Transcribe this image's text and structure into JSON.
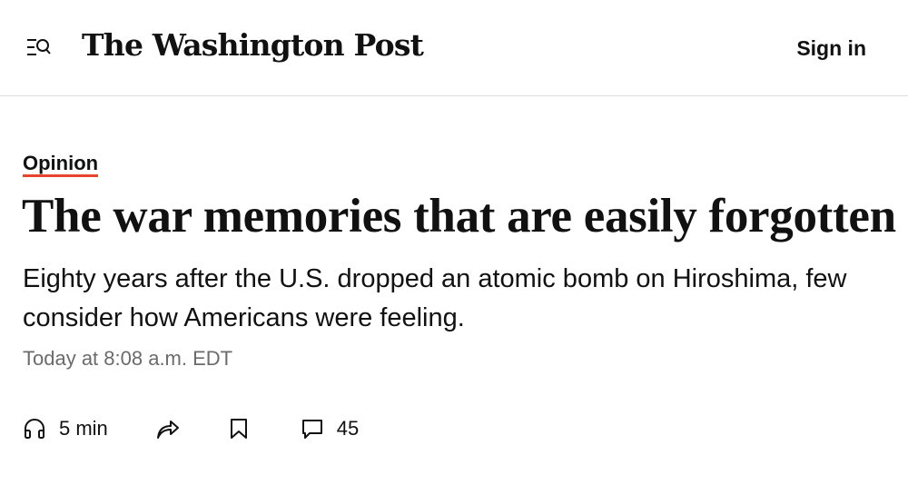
{
  "header": {
    "logo_text": "The Washington Post",
    "sign_in_label": "Sign in"
  },
  "article": {
    "kicker": "Opinion",
    "headline": "The war memories that are easily forgotten",
    "subhead": "Eighty years after the U.S. dropped an atomic bomb on Hiroshima, few consider how Americans were feeling.",
    "timestamp": "Today at 8:08 a.m. EDT"
  },
  "actions": {
    "listen_label": "5 min",
    "comments_count": "45"
  },
  "colors": {
    "accent_underline": "#e8432c",
    "divider": "#dcdcdc",
    "muted_text": "#6b6b6b"
  },
  "icons": [
    "menu-search-icon",
    "headphones-icon",
    "share-icon",
    "bookmark-icon",
    "comment-icon"
  ]
}
